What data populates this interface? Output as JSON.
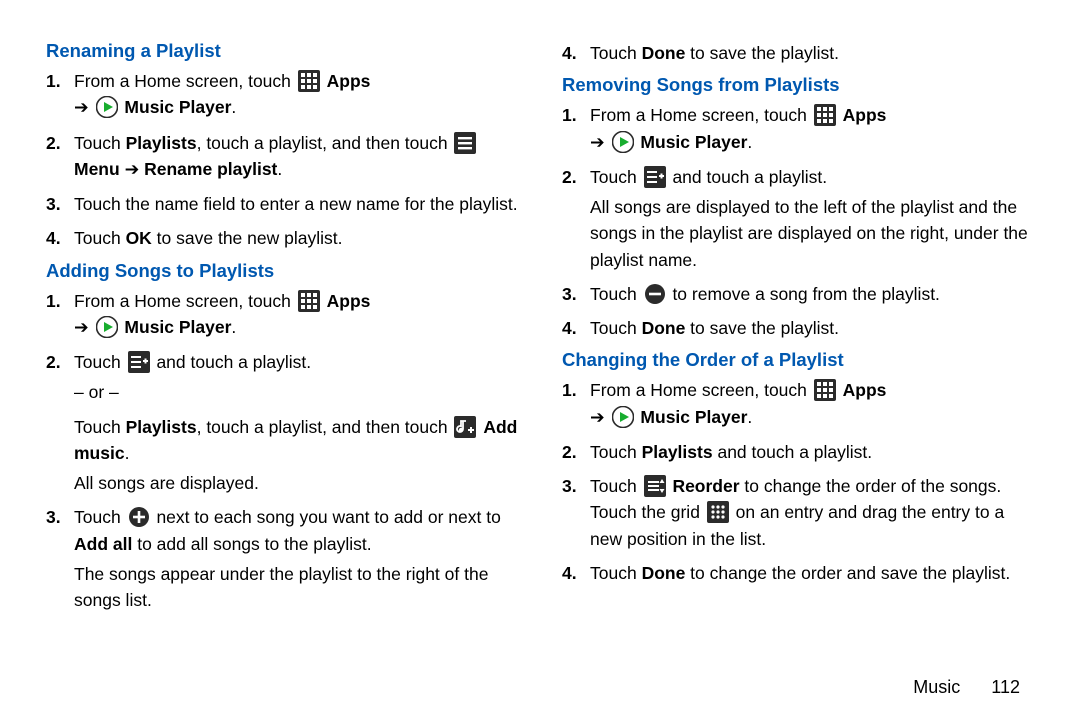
{
  "arrow": "➔",
  "common": {
    "from_home": "From a Home screen, touch ",
    "apps": "Apps",
    "music_player": "Music Player",
    "done_save": " to save the playlist.",
    "touch": "Touch ",
    "done": "Done"
  },
  "left": {
    "renaming": {
      "title": "Renaming a Playlist",
      "s2a": "Touch ",
      "s2_playlists": "Playlists",
      "s2b": ", touch a playlist, and then touch ",
      "menu": "Menu",
      "rename": "Rename playlist",
      "s3": "Touch the name field to enter a new name for the playlist.",
      "s4a": "Touch ",
      "ok": "OK",
      "s4b": " to save the new playlist."
    },
    "adding": {
      "title": "Adding Songs to Playlists",
      "s2a": "Touch ",
      "s2b": " and touch a playlist.",
      "or": "– or –",
      "s2c": "Touch ",
      "s2_playlists": "Playlists",
      "s2d": ", touch a playlist, and then touch ",
      "add_music": "Add music",
      "all_songs": "All songs are displayed.",
      "s3a": "Touch ",
      "s3b": " next to each song you want to add or next to ",
      "add_all": "Add all",
      "s3c": " to add all songs to the playlist.",
      "s3p": "The songs appear under the playlist to the right of the songs list."
    }
  },
  "right": {
    "s4_top_a": "Touch ",
    "s4_top_b": " to save the playlist.",
    "removing": {
      "title": "Removing Songs from Playlists",
      "s2a": "Touch ",
      "s2b": " and touch a playlist.",
      "s2p": "All songs are displayed to the left of the playlist and the songs in the playlist are displayed on the right, under the playlist name.",
      "s3a": "Touch ",
      "s3b": " to remove a song from the playlist.",
      "s4a": "Touch ",
      "s4b": " to save the playlist."
    },
    "changing": {
      "title": "Changing the Order of a Playlist",
      "s2a": "Touch ",
      "s2_playlists": "Playlists",
      "s2b": " and touch a playlist.",
      "s3a": "Touch ",
      "reorder": "Reorder",
      "s3b": " to change the order of the songs. Touch the grid ",
      "s3c": " on an entry and drag the entry to a new position in the list.",
      "s4a": "Touch ",
      "s4b": " to change the order and save the playlist."
    }
  },
  "footer": {
    "section": "Music",
    "page": "112"
  }
}
